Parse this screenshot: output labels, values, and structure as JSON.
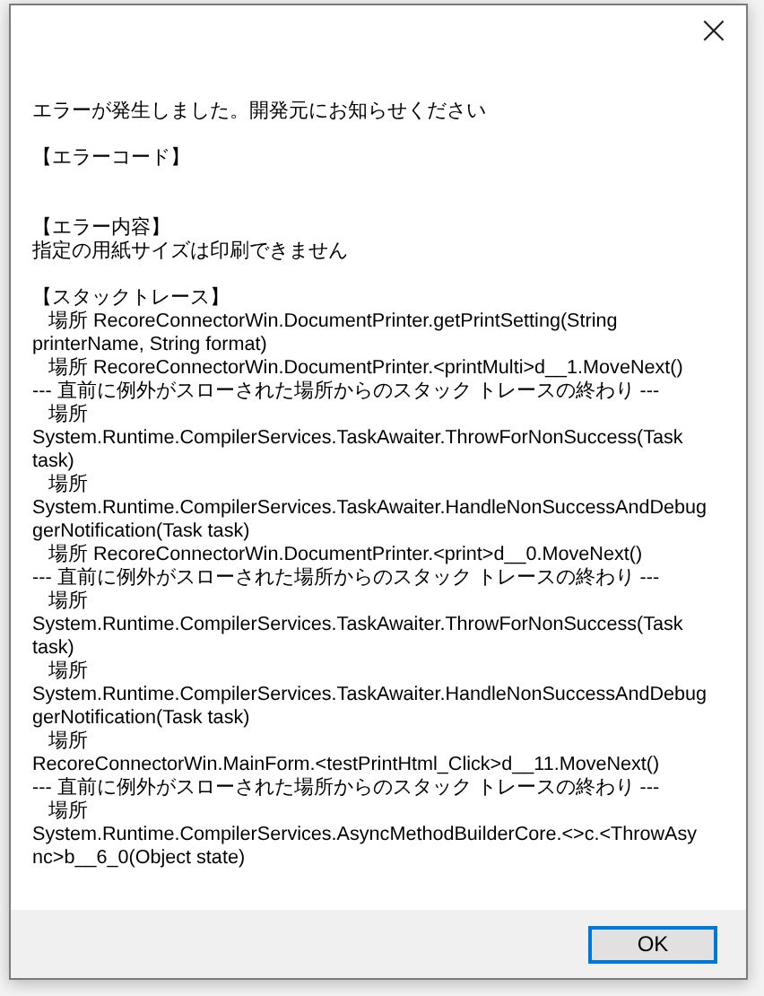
{
  "dialog": {
    "close_symbol": "×",
    "blocks": [
      {
        "lines": [
          "エラーが発生しました。開発元にお知らせください"
        ]
      },
      {
        "lines": [
          "【エラーコード】"
        ]
      },
      {
        "lines": [
          "【エラー内容】",
          "指定の用紙サイズは印刷できません"
        ]
      },
      {
        "lines": [
          "【スタックトレース】",
          "   場所 RecoreConnectorWin.DocumentPrinter.getPrintSetting(String",
          "printerName, String format)",
          "   場所 RecoreConnectorWin.DocumentPrinter.<printMulti>d__1.MoveNext()",
          "--- 直前に例外がスローされた場所からのスタック トレースの終わり ---",
          "   場所",
          "System.Runtime.CompilerServices.TaskAwaiter.ThrowForNonSuccess(Task",
          "task)",
          "   場所",
          "System.Runtime.CompilerServices.TaskAwaiter.HandleNonSuccessAndDebug",
          "gerNotification(Task task)",
          "   場所 RecoreConnectorWin.DocumentPrinter.<print>d__0.MoveNext()",
          "--- 直前に例外がスローされた場所からのスタック トレースの終わり ---",
          "   場所",
          "System.Runtime.CompilerServices.TaskAwaiter.ThrowForNonSuccess(Task",
          "task)",
          "   場所",
          "System.Runtime.CompilerServices.TaskAwaiter.HandleNonSuccessAndDebug",
          "gerNotification(Task task)",
          "   場所",
          "RecoreConnectorWin.MainForm.<testPrintHtml_Click>d__11.MoveNext()",
          "--- 直前に例外がスローされた場所からのスタック トレースの終わり ---",
          "   場所",
          "System.Runtime.CompilerServices.AsyncMethodBuilderCore.<>c.<ThrowAsy",
          "nc>b__6_0(Object state)"
        ]
      }
    ],
    "buttons": [
      {
        "label": "OK",
        "focused": true
      }
    ]
  }
}
